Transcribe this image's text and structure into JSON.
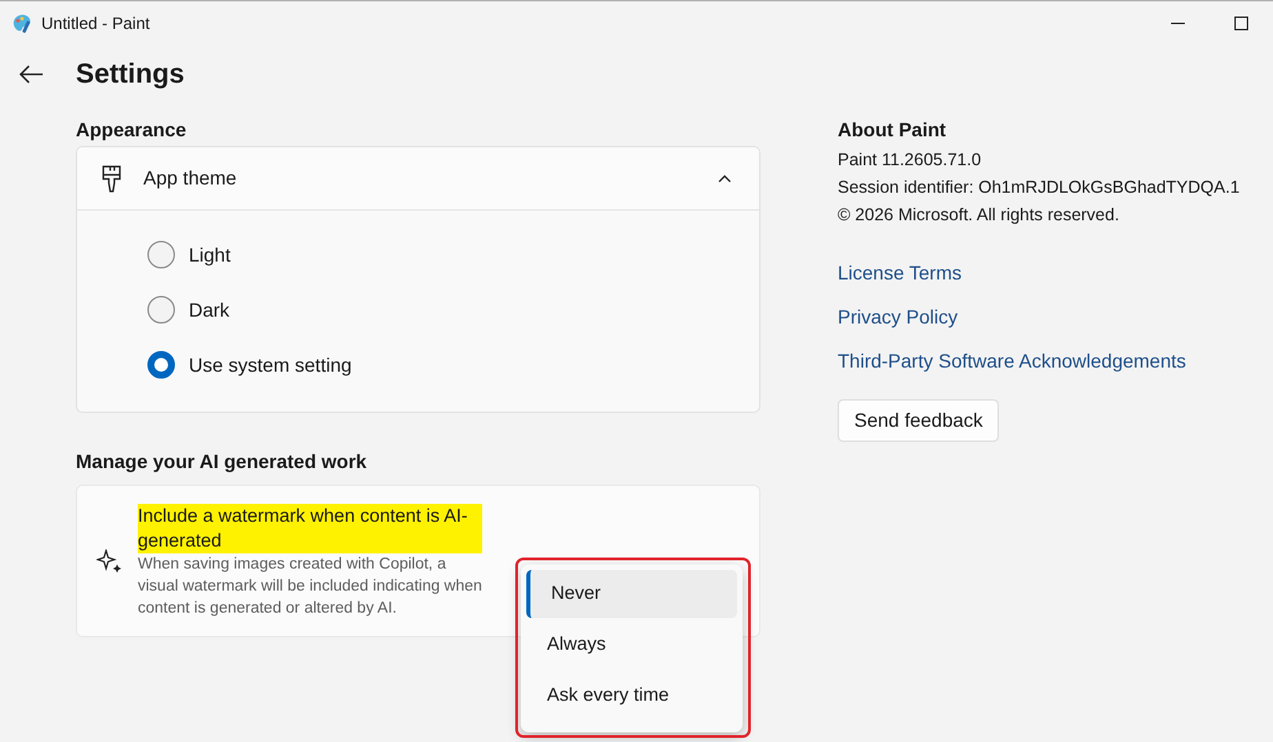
{
  "window": {
    "title": "Untitled - Paint"
  },
  "page_title": "Settings",
  "appearance": {
    "heading": "Appearance",
    "app_theme": {
      "label": "App theme",
      "expanded": true,
      "options": [
        {
          "label": "Light",
          "selected": false
        },
        {
          "label": "Dark",
          "selected": false
        },
        {
          "label": "Use system setting",
          "selected": true
        }
      ]
    }
  },
  "ai_work": {
    "heading": "Manage your AI generated work",
    "title": "Include a watermark when content is AI-generated",
    "highlighted": true,
    "description": "When saving images created with Copilot, a visual watermark will be included indicating when content is generated or altered by AI.",
    "dropdown": {
      "annotated": true,
      "options": [
        {
          "label": "Never",
          "selected": true
        },
        {
          "label": "Always",
          "selected": false
        },
        {
          "label": "Ask every time",
          "selected": false
        }
      ]
    }
  },
  "about": {
    "heading": "About Paint",
    "lines": [
      "Paint 11.2605.71.0",
      "Session identifier: Oh1mRJDLOkGsBGhadTYDQA.1",
      "© 2026 Microsoft. All rights reserved."
    ],
    "links": [
      "License Terms",
      "Privacy Policy",
      "Third-Party Software Acknowledgements"
    ],
    "feedback_button": "Send feedback"
  }
}
